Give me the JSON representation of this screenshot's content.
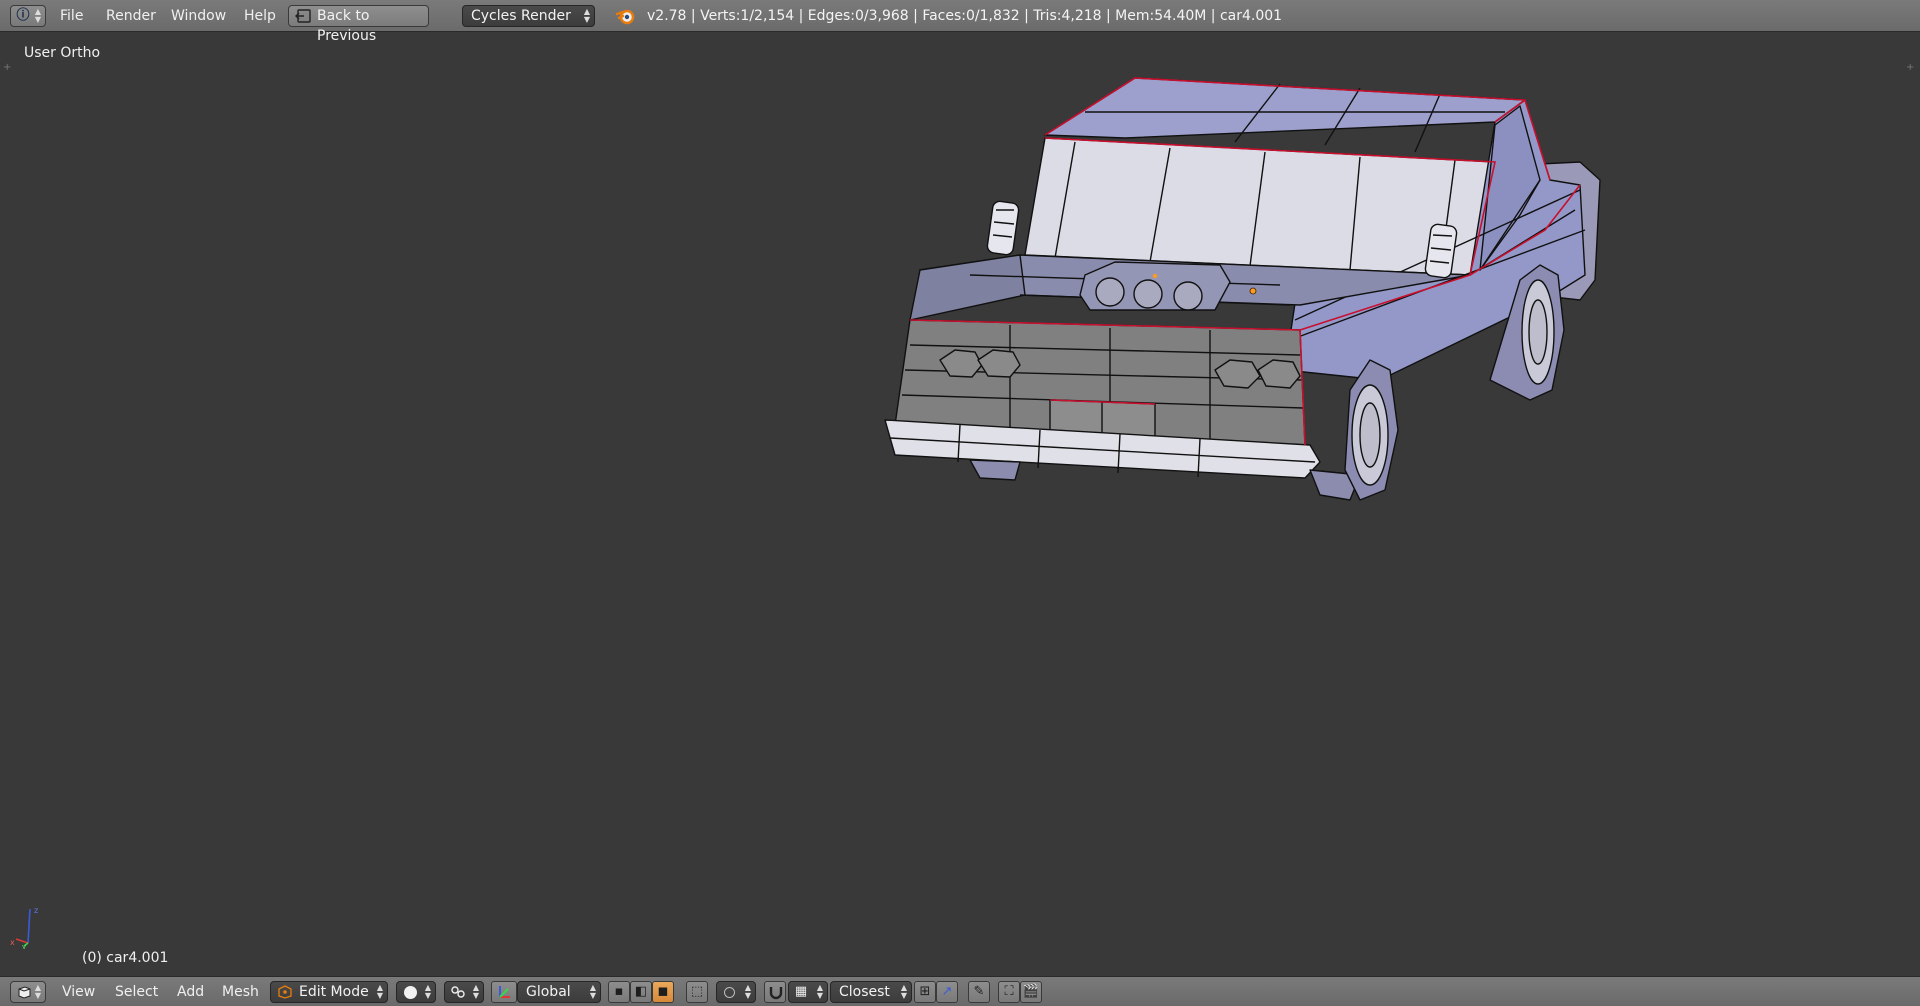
{
  "top_header": {
    "menus": [
      "File",
      "Render",
      "Window",
      "Help"
    ],
    "back_button": "Back to Previous",
    "render_engine": "Cycles Render",
    "stats": "v2.78 | Verts:1/2,154 | Edges:0/3,968 | Faces:0/1,832 | Tris:4,218 | Mem:54.40M | car4.001"
  },
  "viewport": {
    "view_name": "User Ortho",
    "object_info": "(0) car4.001",
    "axis_labels": {
      "z": "z",
      "y": "y",
      "x": "x"
    }
  },
  "bottom_header": {
    "menus": [
      "View",
      "Select",
      "Add",
      "Mesh"
    ],
    "mode": "Edit Mode",
    "transform_orientation": "Global",
    "snap_target": "Closest"
  },
  "colors": {
    "viewport_bg": "#393939",
    "header_bg": "#727272",
    "mesh_face": "#9a9dc4",
    "mesh_edge": "#111111",
    "seam_edge": "#c8102e",
    "selected_vertex": "#ff9a1f"
  },
  "icons": {
    "info_editor": "info-icon",
    "back": "back-icon",
    "blender": "blender-logo-icon",
    "view3d_editor": "view3d-icon",
    "shading": "solid-sphere-icon",
    "pivot": "pivot-icon",
    "manipulator": "manipulator-icon",
    "snap": "magnet-icon"
  }
}
